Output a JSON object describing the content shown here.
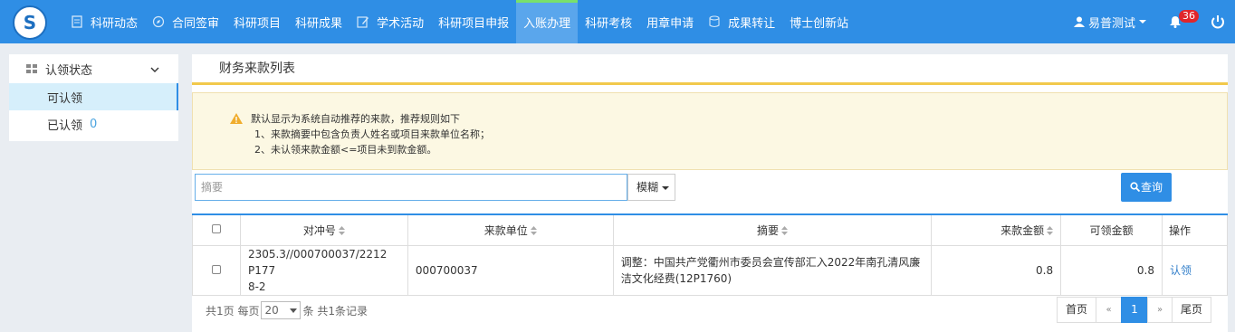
{
  "nav": {
    "items": [
      {
        "label": "科研动态",
        "icon": "document-icon"
      },
      {
        "label": "合同签审",
        "icon": "compass-icon"
      },
      {
        "label": "科研项目",
        "icon": ""
      },
      {
        "label": "科研成果",
        "icon": ""
      },
      {
        "label": "学术活动",
        "icon": "edit-icon"
      },
      {
        "label": "科研项目申报",
        "icon": ""
      },
      {
        "label": "入账办理",
        "icon": ""
      },
      {
        "label": "科研考核",
        "icon": ""
      },
      {
        "label": "用章申请",
        "icon": ""
      },
      {
        "label": "成果转让",
        "icon": "database-icon"
      },
      {
        "label": "博士创新站",
        "icon": ""
      }
    ],
    "active_index": 6,
    "user_name": "易普测试",
    "notification_count": "36"
  },
  "sidebar": {
    "group_label": "认领状态",
    "items": [
      {
        "label": "可认领",
        "count": ""
      },
      {
        "label": "已认领",
        "count": "0"
      }
    ]
  },
  "main": {
    "title": "财务来款列表",
    "notice": {
      "lines": [
        "默认显示为系统自动推荐的来款，推荐规则如下",
        "1、来款摘要中包含负责人姓名或项目来款单位名称；",
        "2、未认领来款金额<=项目未到款金额。"
      ]
    },
    "search": {
      "placeholder": "摘要",
      "mode_label": "模糊",
      "query_label": "查询"
    },
    "table": {
      "headers": [
        "对冲号",
        "来款单位",
        "摘要",
        "来款金额",
        "可领金额",
        "操作"
      ],
      "rows": [
        {
          "ref_line1": "2305.3//000700037/2212 P177",
          "ref_line2": "8-2",
          "payer": "000700037",
          "summary_line1": "调整：中国共产党衢州市委员会宣传部汇入2022年南孔清风廉",
          "summary_line2": "洁文化经费(12P1760)",
          "amount": "0.8",
          "claimable": "0.8",
          "action": "认领"
        }
      ]
    },
    "pagination": {
      "total_pages_text": "共1页",
      "per_page_prefix": "每页",
      "per_page_value": "20",
      "per_page_suffix": "条",
      "total_records_text": "共1条记录",
      "first": "首页",
      "prev": "«",
      "current": "1",
      "next": "»",
      "last": "尾页"
    }
  },
  "colors": {
    "nav_bg": "#2f8ee5",
    "nav_active_top": "#79e06b",
    "notice_bg": "#fcf8e3",
    "badge": "#e0262b",
    "link": "#2f7dc9"
  }
}
